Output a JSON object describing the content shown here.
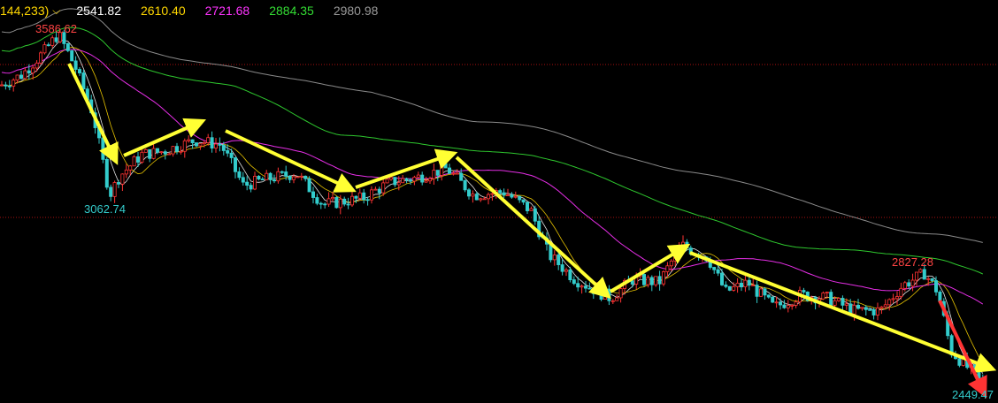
{
  "header": {
    "ma_params": "144,233)",
    "ma_values": [
      {
        "value": "2541.82",
        "color": "#ffffff"
      },
      {
        "value": "2610.40",
        "color": "#ffd700"
      },
      {
        "value": "2721.68",
        "color": "#ff33ff"
      },
      {
        "value": "2884.35",
        "color": "#33dd33"
      },
      {
        "value": "2980.98",
        "color": "#999999"
      }
    ]
  },
  "chart_data": {
    "type": "candlestick",
    "annotations": [
      {
        "label": "3586.62",
        "value": 3586.62,
        "kind": "high",
        "color": "#ff4444"
      },
      {
        "label": "3062.74",
        "value": 3062.74,
        "kind": "low",
        "color": "#33cccc"
      },
      {
        "label": "2827.28",
        "value": 2827.28,
        "kind": "high",
        "color": "#ff4444"
      },
      {
        "label": "2449.47",
        "value": 2449.47,
        "kind": "low",
        "color": "#33cccc"
      }
    ],
    "colors": {
      "up": "#ff3333",
      "down": "#33cccc",
      "trend": "#ffff33",
      "trend_last": "#ff3333",
      "grid": "#aa1111"
    }
  }
}
